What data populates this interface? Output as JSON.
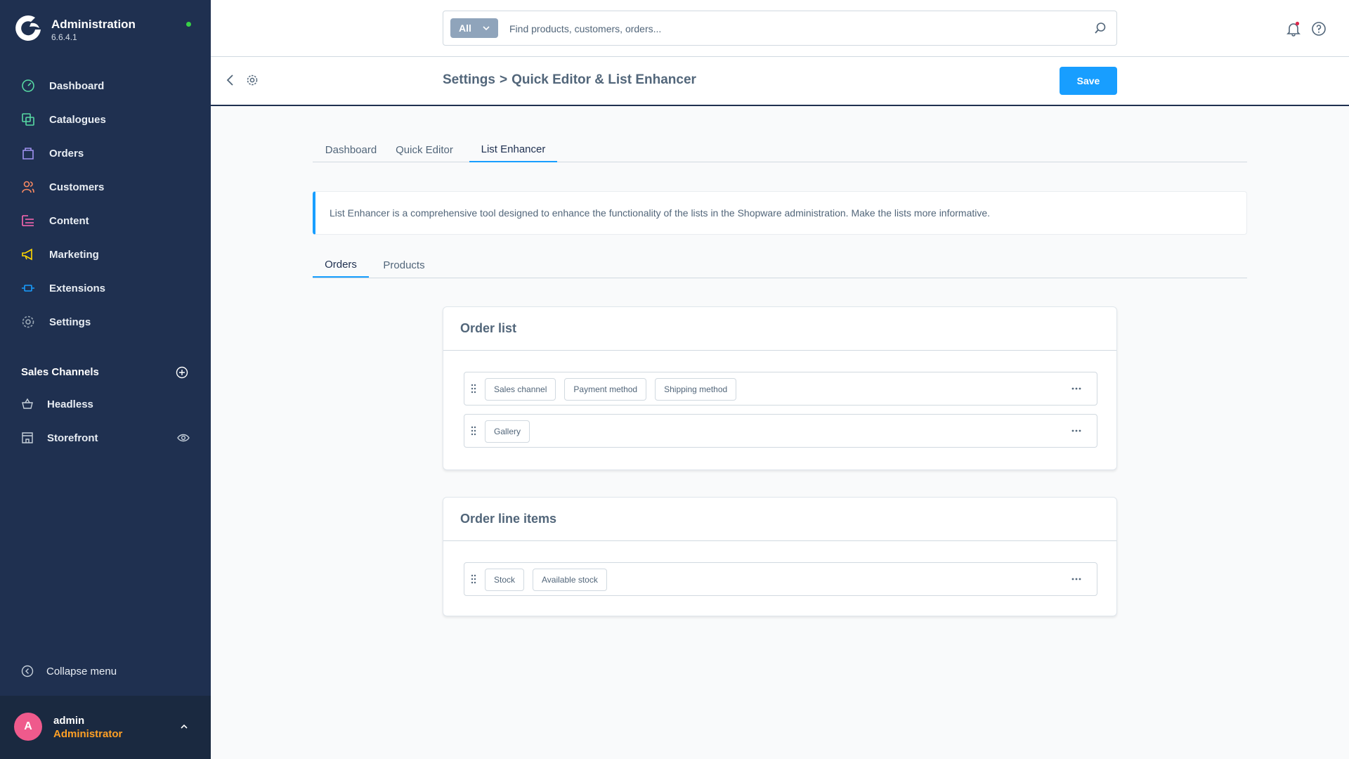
{
  "app": {
    "title": "Administration",
    "version": "6.6.4.1"
  },
  "sidebar": {
    "items": [
      {
        "label": "Dashboard",
        "icon": "dashboard-icon",
        "color": "#57d9a3"
      },
      {
        "label": "Catalogues",
        "icon": "catalogues-icon",
        "color": "#57d9a3"
      },
      {
        "label": "Orders",
        "icon": "orders-icon",
        "color": "#a092f0"
      },
      {
        "label": "Customers",
        "icon": "customers-icon",
        "color": "#f88962"
      },
      {
        "label": "Content",
        "icon": "content-icon",
        "color": "#ff68b4"
      },
      {
        "label": "Marketing",
        "icon": "marketing-icon",
        "color": "#ffd700"
      },
      {
        "label": "Extensions",
        "icon": "extensions-icon",
        "color": "#189eff"
      },
      {
        "label": "Settings",
        "icon": "settings-icon",
        "color": "#9aa8b5"
      }
    ],
    "sales_channels_heading": "Sales Channels",
    "sales_channels": [
      {
        "label": "Headless",
        "icon": "basket-icon"
      },
      {
        "label": "Storefront",
        "icon": "storefront-icon"
      }
    ],
    "collapse_label": "Collapse menu",
    "user": {
      "initial": "A",
      "name": "admin",
      "role": "Administrator"
    }
  },
  "search": {
    "type": "All",
    "placeholder": "Find products, customers, orders..."
  },
  "smartbar": {
    "crumb_root": "Settings",
    "crumb_sep": ">",
    "crumb_page": "Quick Editor & List Enhancer",
    "save_label": "Save"
  },
  "tabs": [
    "Dashboard",
    "Quick Editor",
    "List Enhancer"
  ],
  "alert_text": "List Enhancer is a comprehensive tool designed to enhance the functionality of the lists in the Shopware administration. Make the lists more informative.",
  "subtabs": [
    "Orders",
    "Products"
  ],
  "cards": [
    {
      "title": "Order list",
      "rows": [
        [
          "Sales channel",
          "Payment method",
          "Shipping method"
        ],
        [
          "Gallery"
        ]
      ]
    },
    {
      "title": "Order line items",
      "rows": [
        [
          "Stock",
          "Available stock"
        ]
      ]
    }
  ],
  "colors": {
    "sidebar": "#1f3050",
    "accent": "#189eff",
    "role": "#ffa025",
    "avatar": "#ef5a8c"
  }
}
